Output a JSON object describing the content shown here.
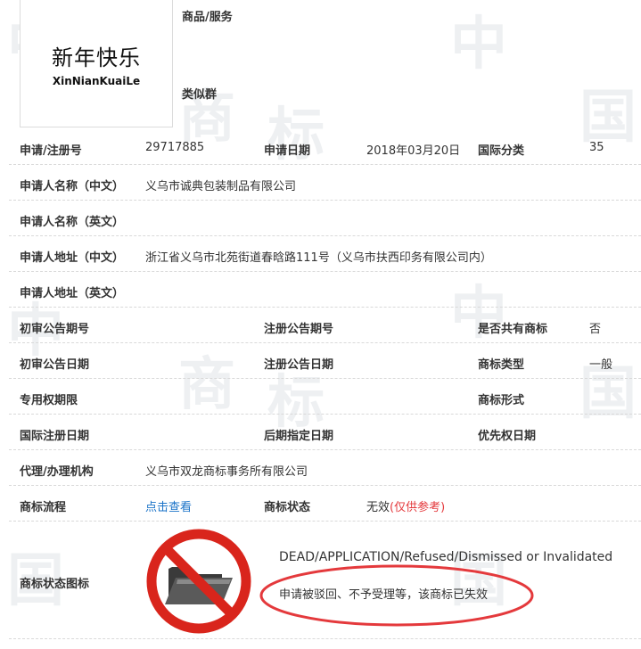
{
  "watermark": {
    "char1": "中",
    "char2": "国",
    "char3": "商",
    "char4": "标"
  },
  "logo": {
    "cn": "新年快乐",
    "en": "XinNianKuaiLe"
  },
  "header": {
    "goods_services_label": "商品/服务",
    "similar_group_label": "类似群"
  },
  "rows": {
    "reg_no": {
      "label": "申请/注册号",
      "value": "29717885"
    },
    "apply_date": {
      "label": "申请日期",
      "value": "2018年03月20日"
    },
    "intl_class": {
      "label": "国际分类",
      "value": "35"
    },
    "applicant_cn": {
      "label": "申请人名称（中文）",
      "value": "义乌市诚典包装制品有限公司"
    },
    "applicant_en": {
      "label": "申请人名称（英文）",
      "value": ""
    },
    "address_cn": {
      "label": "申请人地址（中文）",
      "value": "浙江省义乌市北苑街道春晗路111号（义乌市扶西印务有限公司内）"
    },
    "address_en": {
      "label": "申请人地址（英文）",
      "value": ""
    },
    "prelim_pub_no": {
      "label": "初审公告期号",
      "value": ""
    },
    "reg_pub_no": {
      "label": "注册公告期号",
      "value": ""
    },
    "shared_mark": {
      "label": "是否共有商标",
      "value": "否"
    },
    "prelim_pub_date": {
      "label": "初审公告日期",
      "value": ""
    },
    "reg_pub_date": {
      "label": "注册公告日期",
      "value": ""
    },
    "mark_type": {
      "label": "商标类型",
      "value": "一般"
    },
    "exclusive_period": {
      "label": "专用权期限",
      "value": ""
    },
    "mark_form": {
      "label": "商标形式",
      "value": ""
    },
    "intl_reg_date": {
      "label": "国际注册日期",
      "value": ""
    },
    "later_designation_date": {
      "label": "后期指定日期",
      "value": ""
    },
    "priority_date": {
      "label": "优先权日期",
      "value": ""
    },
    "agent": {
      "label": "代理/办理机构",
      "value": "义乌市双龙商标事务所有限公司"
    },
    "process": {
      "label": "商标流程",
      "link": "点击查看"
    },
    "status": {
      "label": "商标状态",
      "value": "无效",
      "note": "(仅供参考)"
    },
    "status_icon": {
      "label": "商标状态图标"
    }
  },
  "status_detail": {
    "en": "DEAD/APPLICATION/Refused/Dismissed or Invalidated",
    "cn": "申请被驳回、不予受理等，该商标已失效"
  },
  "colors": {
    "accent_link": "#1a73c8",
    "alert_red": "#e4393c",
    "ring_red": "#d9251c"
  },
  "icons": {
    "status": "prohibited-folder-icon"
  }
}
